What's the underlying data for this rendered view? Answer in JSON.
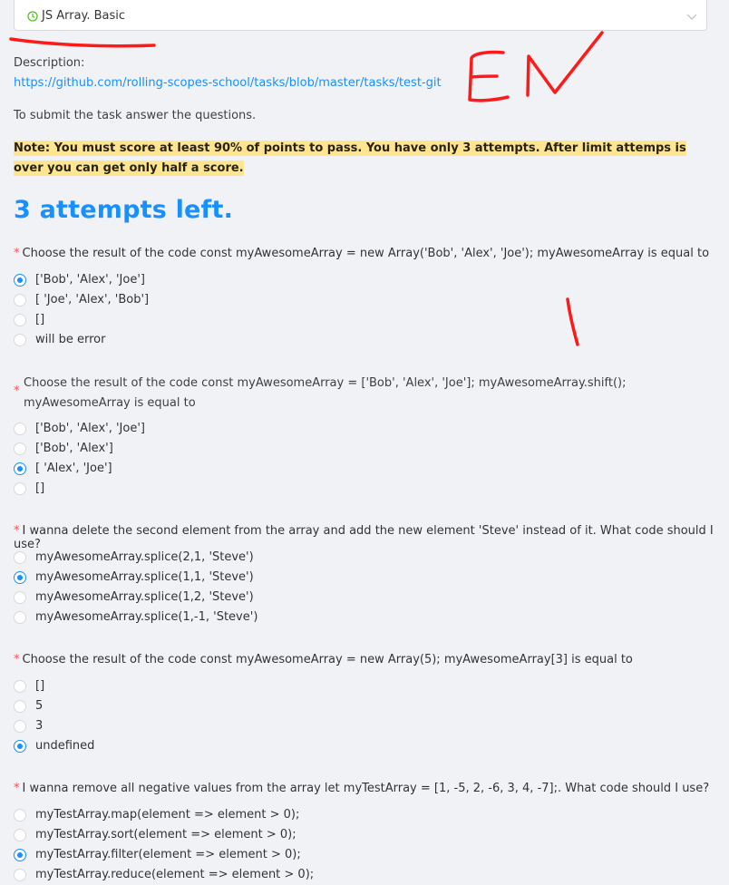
{
  "task_select": {
    "title": "JS Array. Basic",
    "icon": "clock-circle-icon",
    "chevron": "chevron-down-icon"
  },
  "description_label": "Description:",
  "description_link": "https://github.com/rolling-scopes-school/tasks/blob/master/tasks/test-git",
  "submit_text": "To submit the task answer the questions.",
  "note": "Note: You must score at least 90% of points to pass. You have only 3 attempts. After limit attemps is over you can get only half a score.",
  "attempts_left": "3 attempts left.",
  "questions": [
    {
      "text": "Choose the result of the code const myAwesomeArray = new Array('Bob', 'Alex', 'Joe'); myAwesomeArray is equal to",
      "options": [
        "['Bob', 'Alex', 'Joe']",
        "[ 'Joe', 'Alex', 'Bob']",
        "[]",
        "will be error"
      ],
      "selected": 0
    },
    {
      "text": "Choose the result of the code const myAwesomeArray = ['Bob', 'Alex', 'Joe']; myAwesomeArray.shift(); myAwesomeArray is equal to",
      "options": [
        "['Bob', 'Alex', 'Joe']",
        "['Bob', 'Alex']",
        "[ 'Alex', 'Joe']",
        "[]"
      ],
      "selected": 2
    },
    {
      "text": "I wanna delete the second element from the array and add the new element 'Steve' instead of it. What code should I use?",
      "options": [
        "myAwesomeArray.splice(2,1, 'Steve')",
        "myAwesomeArray.splice(1,1, 'Steve')",
        "myAwesomeArray.splice(1,2, 'Steve')",
        "myAwesomeArray.splice(1,-1, 'Steve')"
      ],
      "selected": 1
    },
    {
      "text": "Choose the result of the code const myAwesomeArray = new Array(5); myAwesomeArray[3] is equal to",
      "options": [
        "[]",
        "5",
        "3",
        "undefined"
      ],
      "selected": 3
    },
    {
      "text": "I wanna remove all negative values from the array let myTestArray = [1, -5, 2, -6, 3, 4, -7];. What code should I use?",
      "options": [
        "myTestArray.map(element => element > 0);",
        "myTestArray.sort(element => element > 0);",
        "myTestArray.filter(element => element > 0);",
        "myTestArray.reduce(element => element > 0);"
      ],
      "selected": 2
    }
  ],
  "annotation_color": "#ff1a1a",
  "accent_color": "#1890ff"
}
